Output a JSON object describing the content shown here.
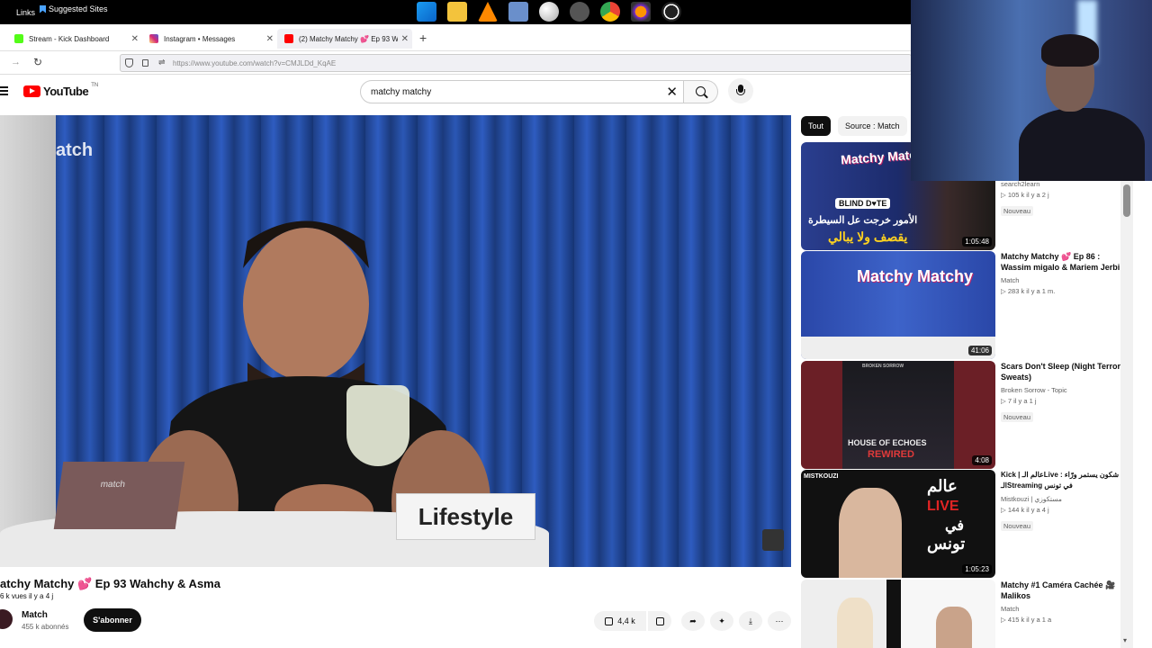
{
  "taskbar": {
    "links_label": "Links",
    "suggested_label": "Suggested Sites",
    "icons": [
      "windows-icon",
      "file-explorer-icon",
      "vlc-icon",
      "remote-icon",
      "sphere-icon",
      "satellite-icon",
      "chrome-icon",
      "firefox-icon",
      "obs-icon"
    ]
  },
  "tabs": [
    {
      "label": "Stream - Kick Dashboard",
      "color": "#53fc18"
    },
    {
      "label": "Instagram • Messages",
      "color": "#d6249f"
    },
    {
      "label": "(2) Matchy Matchy 💕 Ep 93 Wah",
      "color": "#ff0000"
    }
  ],
  "address": {
    "url": "https://www.youtube.com/watch?v=CMJLDd_KqAE"
  },
  "youtube": {
    "logo_text": "YouTube",
    "country": "TN",
    "search_value": "matchy matchy"
  },
  "video": {
    "watermark": "atch",
    "prop_text": "match",
    "sign_text": "Lifestyle",
    "title": "atchy Matchy 💕 Ep 93 Wahchy & Asma",
    "stats": "6 k vues  il y a 4 j",
    "channel": "Match",
    "subscribers": "455 k abonnés",
    "subscribe_label": "S'abonner",
    "likes": "4,4 k",
    "more": "⋯"
  },
  "chips": [
    {
      "label": "Tout"
    },
    {
      "label": "Source : Match"
    }
  ],
  "recommendations": [
    {
      "thumb_title": "Matchy Matchy",
      "thumb_badge": "BLIND D♥TE",
      "thumb_arabic": "الأمور خرجت عل السيطرة",
      "thumb_arabic2": "يقصف ولا يبالي",
      "duration": "1:05:48",
      "title": "",
      "channel": "search2learn",
      "meta": "▷ 105 k  il y a 2 j",
      "badge": "Nouveau"
    },
    {
      "thumb_title": "Matchy Matchy",
      "duration": "41:06",
      "title": "Matchy Matchy 💕 Ep 86 : Wassim migalo & Mariem Jerbi",
      "channel": "Match",
      "meta": "▷ 283 k  il y a 1 m.",
      "badge": ""
    },
    {
      "thumb_title": "HOUSE OF ECHOES",
      "thumb_sub": "REWIRED",
      "thumb_top": "BROKEN SORROW",
      "duration": "4:08",
      "title": "Scars Don't Sleep (Night Terror Sweats)",
      "channel": "Broken Sorrow - Topic",
      "meta": "▷ 7  il y a 1 j",
      "badge": "Nouveau"
    },
    {
      "thumb_brand": "MISTKOUZI",
      "thumb_arabic": "عالم",
      "thumb_live": "LIVE",
      "thumb_arabic2": "في",
      "thumb_arabic3": "تونس",
      "duration": "1:05:23",
      "title": "Kick | عالم الـLive : شكون يستمر ورّاء الـStreaming في تونس",
      "channel": "Mistkouzi | مستكوزي",
      "meta": "▷ 144 k  il y a 4 j",
      "badge": "Nouveau"
    },
    {
      "duration": "",
      "title": "Matchy #1 Caméra Cachée 🎥 Malikos",
      "channel": "Match",
      "meta": "▷ 415 k  il y a 1 a",
      "badge": ""
    }
  ]
}
